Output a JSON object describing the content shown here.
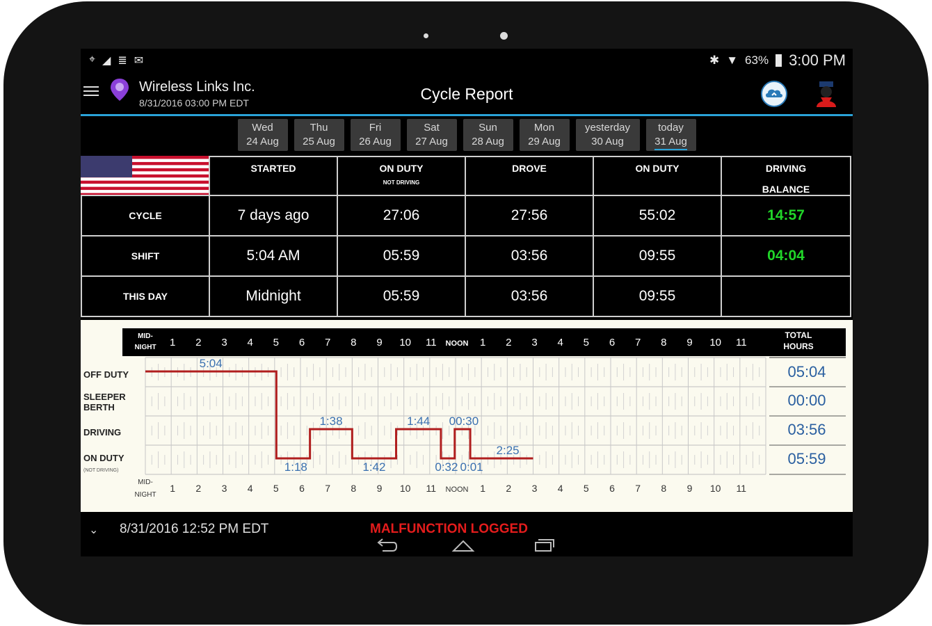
{
  "statusbar": {
    "battery_pct": "63%",
    "clock": "3:00 PM"
  },
  "appbar": {
    "company": "Wireless Links Inc.",
    "datetime": "8/31/2016 03:00 PM EDT",
    "title": "Cycle Report"
  },
  "days": [
    {
      "d1": "Wed",
      "d2": "24 Aug"
    },
    {
      "d1": "Thu",
      "d2": "25 Aug"
    },
    {
      "d1": "Fri",
      "d2": "26 Aug"
    },
    {
      "d1": "Sat",
      "d2": "27 Aug"
    },
    {
      "d1": "Sun",
      "d2": "28 Aug"
    },
    {
      "d1": "Mon",
      "d2": "29 Aug"
    },
    {
      "d1": "yesterday",
      "d2": "30 Aug"
    },
    {
      "d1": "today",
      "d2": "31 Aug"
    }
  ],
  "summary": {
    "headers": {
      "started": "STARTED",
      "onduty_nd": "ON DUTY",
      "onduty_nd_sub": "NOT DRIVING",
      "drove": "DROVE",
      "onduty": "ON DUTY",
      "balance": "DRIVING",
      "balance_sub": "BALANCE"
    },
    "rows": [
      {
        "label": "CYCLE",
        "started": "7 days ago",
        "onduty_nd": "27:06",
        "drove": "27:56",
        "onduty": "55:02",
        "balance": "14:57"
      },
      {
        "label": "SHIFT",
        "started": "5:04 AM",
        "onduty_nd": "05:59",
        "drove": "03:56",
        "onduty": "09:55",
        "balance": "04:04"
      },
      {
        "label": "THIS DAY",
        "started": "Midnight",
        "onduty_nd": "05:59",
        "drove": "03:56",
        "onduty": "09:55",
        "balance": ""
      }
    ]
  },
  "chart_data": {
    "type": "line",
    "hour_labels": [
      "MID-NIGHT",
      "1",
      "2",
      "3",
      "4",
      "5",
      "6",
      "7",
      "8",
      "9",
      "10",
      "11",
      "NOON",
      "1",
      "2",
      "3",
      "4",
      "5",
      "6",
      "7",
      "8",
      "9",
      "10",
      "11"
    ],
    "total_header": "TOTAL HOURS",
    "status_labels": {
      "off": "OFF DUTY",
      "sleeper": "SLEEPER BERTH",
      "driving": "DRIVING",
      "onduty": "ON DUTY",
      "onduty_sub": "(NOT DRIVING)"
    },
    "totals": {
      "off": "05:04",
      "sleeper": "00:00",
      "driving": "03:56",
      "onduty": "05:59"
    },
    "segments": [
      {
        "status": "off",
        "start": 0,
        "end": 5.067
      },
      {
        "status": "onduty",
        "start": 5.067,
        "end": 6.367
      },
      {
        "status": "driving",
        "start": 6.367,
        "end": 8.0
      },
      {
        "status": "onduty",
        "start": 8.0,
        "end": 9.7
      },
      {
        "status": "driving",
        "start": 9.7,
        "end": 11.433
      },
      {
        "status": "onduty",
        "start": 11.433,
        "end": 11.967
      },
      {
        "status": "driving",
        "start": 11.967,
        "end": 12.567
      },
      {
        "status": "onduty",
        "start": 12.567,
        "end": 15.0
      }
    ],
    "duration_labels": [
      "5:04",
      "1:18",
      "1:38",
      "1:42",
      "1:44",
      "0:32",
      "00:30",
      "0:01",
      "2:25"
    ]
  },
  "footer": {
    "timestamp": "8/31/2016 12:52 PM EDT",
    "status": "MALFUNCTION LOGGED"
  },
  "colors": {
    "accent": "#2aa3d8",
    "graph_line": "#b01e1e",
    "balance_green": "#21d629",
    "malfunction": "#e41c1c"
  }
}
